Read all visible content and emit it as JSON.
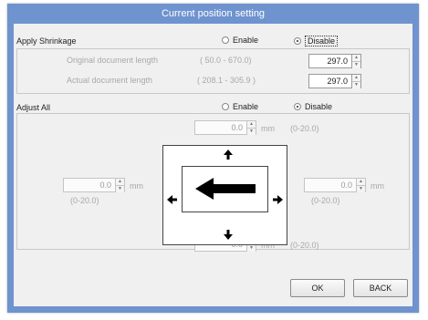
{
  "dialog": {
    "title": "Current position setting"
  },
  "shrinkage": {
    "label": "Apply Shrinkage",
    "enable_label": "Enable",
    "disable_label": "Disable",
    "selected": "disable",
    "original": {
      "label": "Original document length",
      "range": "( 50.0 - 670.0)",
      "value": "297.0"
    },
    "actual": {
      "label": "Actual document length",
      "range": "( 208.1 - 305.9 )",
      "value": "297.0"
    }
  },
  "adjust": {
    "label": "Adjust All",
    "enable_label": "Enable",
    "disable_label": "Disable",
    "selected": "disable",
    "top": {
      "value": "0.0",
      "unit": "mm",
      "range": "(0-20.0)"
    },
    "left": {
      "value": "0.0",
      "unit": "mm",
      "range": "(0-20.0)"
    },
    "right": {
      "value": "0.0",
      "unit": "mm",
      "range": "(0-20.0)"
    },
    "bottom": {
      "value": "0.0",
      "unit": "mm",
      "range": "(0-20.0)"
    }
  },
  "buttons": {
    "ok": "OK",
    "back": "BACK"
  },
  "icons": {
    "up": "arrow-up-icon",
    "down": "arrow-down-icon",
    "left": "arrow-left-icon",
    "right": "arrow-right-icon",
    "feed": "feed-direction-arrow-icon"
  },
  "colors": {
    "titlebar": "#6f93cf",
    "client": "#f0f0f0"
  }
}
